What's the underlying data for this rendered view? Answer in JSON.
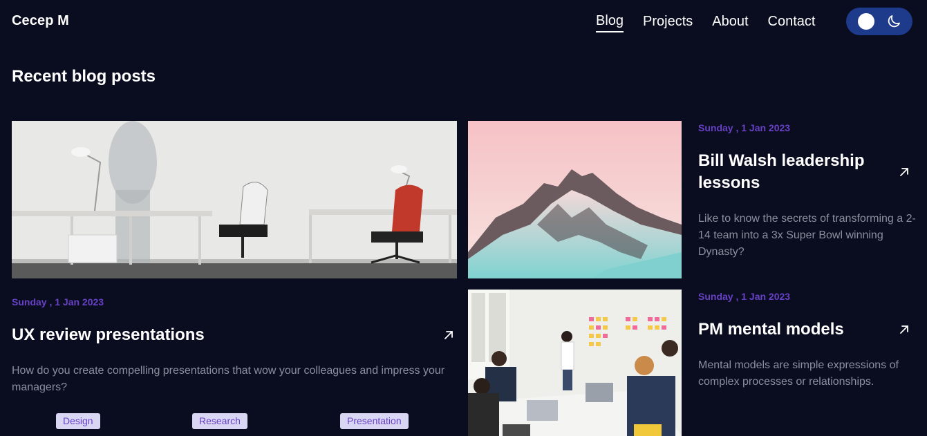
{
  "header": {
    "brand": "Cecep M",
    "nav": [
      {
        "label": "Blog",
        "active": true
      },
      {
        "label": "Projects",
        "active": false
      },
      {
        "label": "About",
        "active": false
      },
      {
        "label": "Contact",
        "active": false
      }
    ],
    "theme_toggle_icons": [
      "sun-knob-icon",
      "moon-icon"
    ]
  },
  "section_title": "Recent blog posts",
  "posts": [
    {
      "date": "Sunday , 1 Jan 2023",
      "title": "UX review presentations",
      "excerpt": "How do you create compelling presentations that wow your colleagues and impress your managers?",
      "tags": [
        "Design",
        "Research",
        "Presentation"
      ],
      "image": "office-desks-photo"
    },
    {
      "date": "Sunday , 1 Jan 2023",
      "title": "Bill Walsh leadership lessons",
      "excerpt": "Like to know the secrets of transforming a 2-14 team into a 3x Super Bowl winning Dynasty?",
      "image": "snowy-mountain-photo"
    },
    {
      "date": "Sunday , 1 Jan 2023",
      "title": "PM mental models",
      "excerpt": "Mental models are simple expressions of complex processes or relationships.",
      "image": "team-meeting-photo"
    }
  ],
  "colors": {
    "background": "#090d1f",
    "accent": "#6941c6",
    "muted_text": "#8b8f9e",
    "toggle": "#1e3a8a",
    "tag_bg": "#d9d6f3"
  }
}
